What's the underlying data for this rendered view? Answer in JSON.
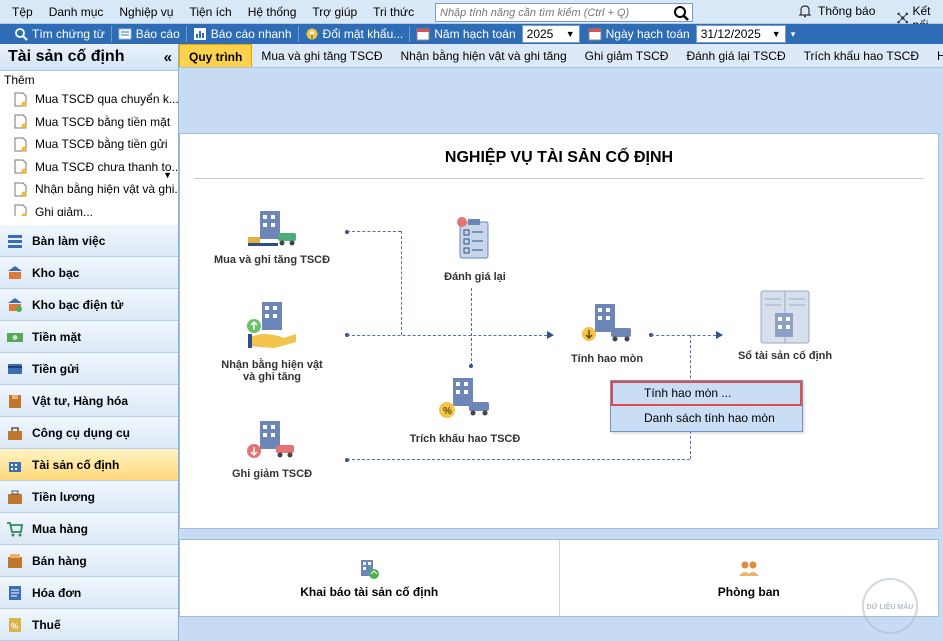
{
  "menu": [
    "Tệp",
    "Danh mục",
    "Nghiệp vụ",
    "Tiện ích",
    "Hệ thống",
    "Trợ giúp",
    "Tri thức"
  ],
  "search": {
    "placeholder": "Nhập tính năng cần tìm kiếm (Ctrl + Q)"
  },
  "topright": {
    "notify": "Thông báo",
    "connect": "Kết nối"
  },
  "toolbar": {
    "find_voucher": "Tìm chứng từ",
    "report": "Báo cáo",
    "quick_report": "Báo cáo nhanh",
    "change_password": "Đổi mật khẩu...",
    "fiscal_year_label": "Năm hạch toán",
    "fiscal_year": "2025",
    "posting_date_label": "Ngày hạch toán",
    "posting_date": "31/12/2025"
  },
  "sidebar": {
    "title": "Tài sản cố định",
    "collapse": "«",
    "add_label": "Thêm",
    "sub_items": [
      "Mua TSCĐ qua chuyển k...",
      "Mua TSCĐ bằng tiền mặt",
      "Mua TSCĐ bằng tiền gửi",
      "Mua TSCĐ chưa thanh to...",
      "Nhận bằng hiện vật và ghi...",
      "Ghi giảm..."
    ],
    "nav": [
      {
        "label": "Bàn làm việc",
        "icon": "desk-icon"
      },
      {
        "label": "Kho bạc",
        "icon": "treasury-icon"
      },
      {
        "label": "Kho bạc điện tử",
        "icon": "e-treasury-icon"
      },
      {
        "label": "Tiền mặt",
        "icon": "cash-icon"
      },
      {
        "label": "Tiền gửi",
        "icon": "deposit-icon"
      },
      {
        "label": "Vật tư, Hàng hóa",
        "icon": "inventory-icon"
      },
      {
        "label": "Công cụ dụng cụ",
        "icon": "tools-icon"
      },
      {
        "label": "Tài sản cố định",
        "icon": "fixed-asset-icon",
        "active": true
      },
      {
        "label": "Tiền lương",
        "icon": "salary-icon"
      },
      {
        "label": "Mua hàng",
        "icon": "purchase-icon"
      },
      {
        "label": "Bán hàng",
        "icon": "sales-icon"
      },
      {
        "label": "Hóa đơn",
        "icon": "invoice-icon"
      },
      {
        "label": "Thuế",
        "icon": "tax-icon"
      }
    ]
  },
  "tabs": [
    "Quy trình",
    "Mua và ghi tăng TSCĐ",
    "Nhận bằng hiện vật và ghi tăng",
    "Ghi giảm TSCĐ",
    "Đánh giá lại TSCĐ",
    "Trích khấu hao TSCĐ",
    "Hao mòn TSCĐ"
  ],
  "process": {
    "title": "NGHIỆP VỤ TÀI SẢN CỐ ĐỊNH",
    "nodes": {
      "buy_increase": "Mua và ghi tăng TSCĐ",
      "receive_in_kind_1": "Nhận bằng hiện vật",
      "receive_in_kind_2": "và ghi tăng",
      "decrease": "Ghi giảm TSCĐ",
      "revaluation": "Đánh giá lại",
      "depreciation": "Trích khấu hao TSCĐ",
      "wear": "Tính hao mòn",
      "ledger": "Sổ tài sản cố định"
    }
  },
  "context_menu": {
    "calc_wear": "Tính hao mòn ...",
    "wear_list": "Danh sách tính hao mòn"
  },
  "bottom": {
    "declare": "Khai báo tài sản cố định",
    "departments": "Phòng ban"
  },
  "watermark": "DỮ LIỆU MẪU"
}
